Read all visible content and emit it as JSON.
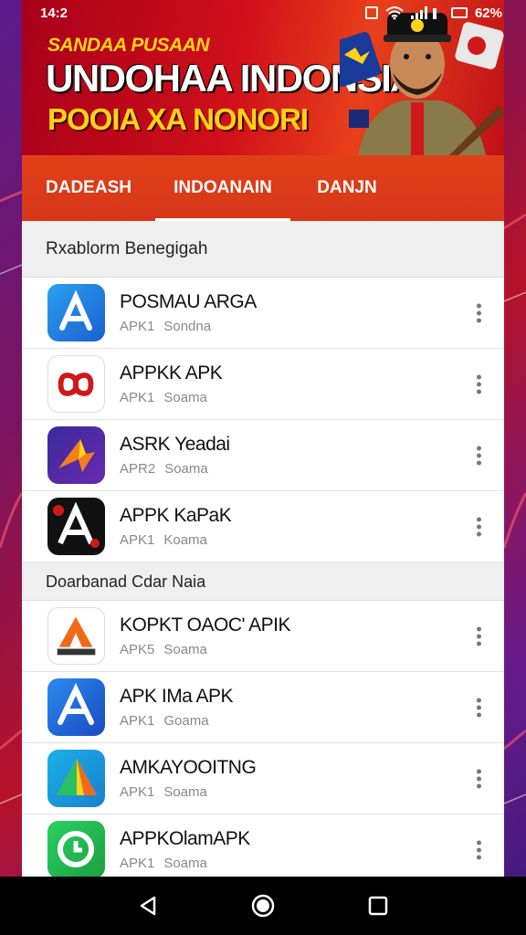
{
  "status_bar": {
    "time": "14:2",
    "battery": "62%"
  },
  "banner": {
    "kicker": "SANDAA PUSAAN",
    "title": "UNDOHAA INDONSIA",
    "subtitle": "POOIA XA NONORI"
  },
  "tabs": [
    {
      "label": "DADEASH",
      "active": false
    },
    {
      "label": "INDOANAIN",
      "active": true
    },
    {
      "label": "DANJN",
      "active": false
    }
  ],
  "sections": [
    {
      "title": "Rxablorm Benegigah",
      "items": [
        {
          "name": "POSMAU ARGA",
          "meta1": "APK1",
          "meta2": "Sondna",
          "icon": "blue-a-icon"
        },
        {
          "name": "APPKK APK",
          "meta1": "APK1",
          "meta2": "Soama",
          "icon": "red-knot-icon"
        },
        {
          "name": "ASRK Yeadai",
          "meta1": "APR2",
          "meta2": "Soama",
          "icon": "purple-bird-icon"
        },
        {
          "name": "APPK KaPaK",
          "meta1": "APK1",
          "meta2": "Koama",
          "icon": "black-a-icon"
        }
      ]
    },
    {
      "title": "Doarbanad Cdar Naia",
      "items": [
        {
          "name": "KOPKT OAOC' APIK",
          "meta1": "APK5",
          "meta2": "Soama",
          "icon": "orange-a-icon"
        },
        {
          "name": "APK IMa APK",
          "meta1": "APK1",
          "meta2": "Goama",
          "icon": "blue-a2-icon"
        },
        {
          "name": "AMKAYOOITNG",
          "meta1": "APK1",
          "meta2": "Soama",
          "icon": "gradient-triangle-icon"
        },
        {
          "name": "APPKOlamAPK",
          "meta1": "APK1",
          "meta2": "Soama",
          "icon": "green-phone-icon"
        }
      ]
    }
  ],
  "colors": {
    "accent": "#d8361a",
    "banner_yellow": "#ffd21a"
  }
}
